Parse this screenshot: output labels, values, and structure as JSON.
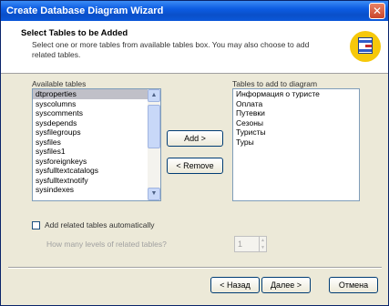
{
  "window": {
    "title": "Create Database Diagram Wizard"
  },
  "header": {
    "title": "Select Tables to be Added",
    "description": "Select one or more tables from available tables box. You may also choose to add related tables."
  },
  "available": {
    "label": "Available tables",
    "items": [
      "dtproperties",
      "syscolumns",
      "syscomments",
      "sysdepends",
      "sysfilegroups",
      "sysfiles",
      "sysfiles1",
      "sysforeignkeys",
      "sysfulltextcatalogs",
      "sysfulltextnotify",
      "sysindexes"
    ],
    "selected_index": 0
  },
  "target": {
    "label": "Tables to add to diagram",
    "items": [
      "Информация о туристе",
      "Оплата",
      "Путевки",
      "Сезоны",
      "Туристы",
      "Туры"
    ]
  },
  "buttons": {
    "add": "Add >",
    "remove": "< Remove",
    "back": "< Назад",
    "next": "Далее >",
    "cancel": "Отмена"
  },
  "options": {
    "related_label": "Add related tables automatically",
    "related_checked": false,
    "levels_label": "How many levels of related tables?",
    "levels_value": "1"
  },
  "colors": {
    "titlebar": "#0a4fc9",
    "dialog": "#ece9d8",
    "icon_bg": "#f6c80a"
  }
}
